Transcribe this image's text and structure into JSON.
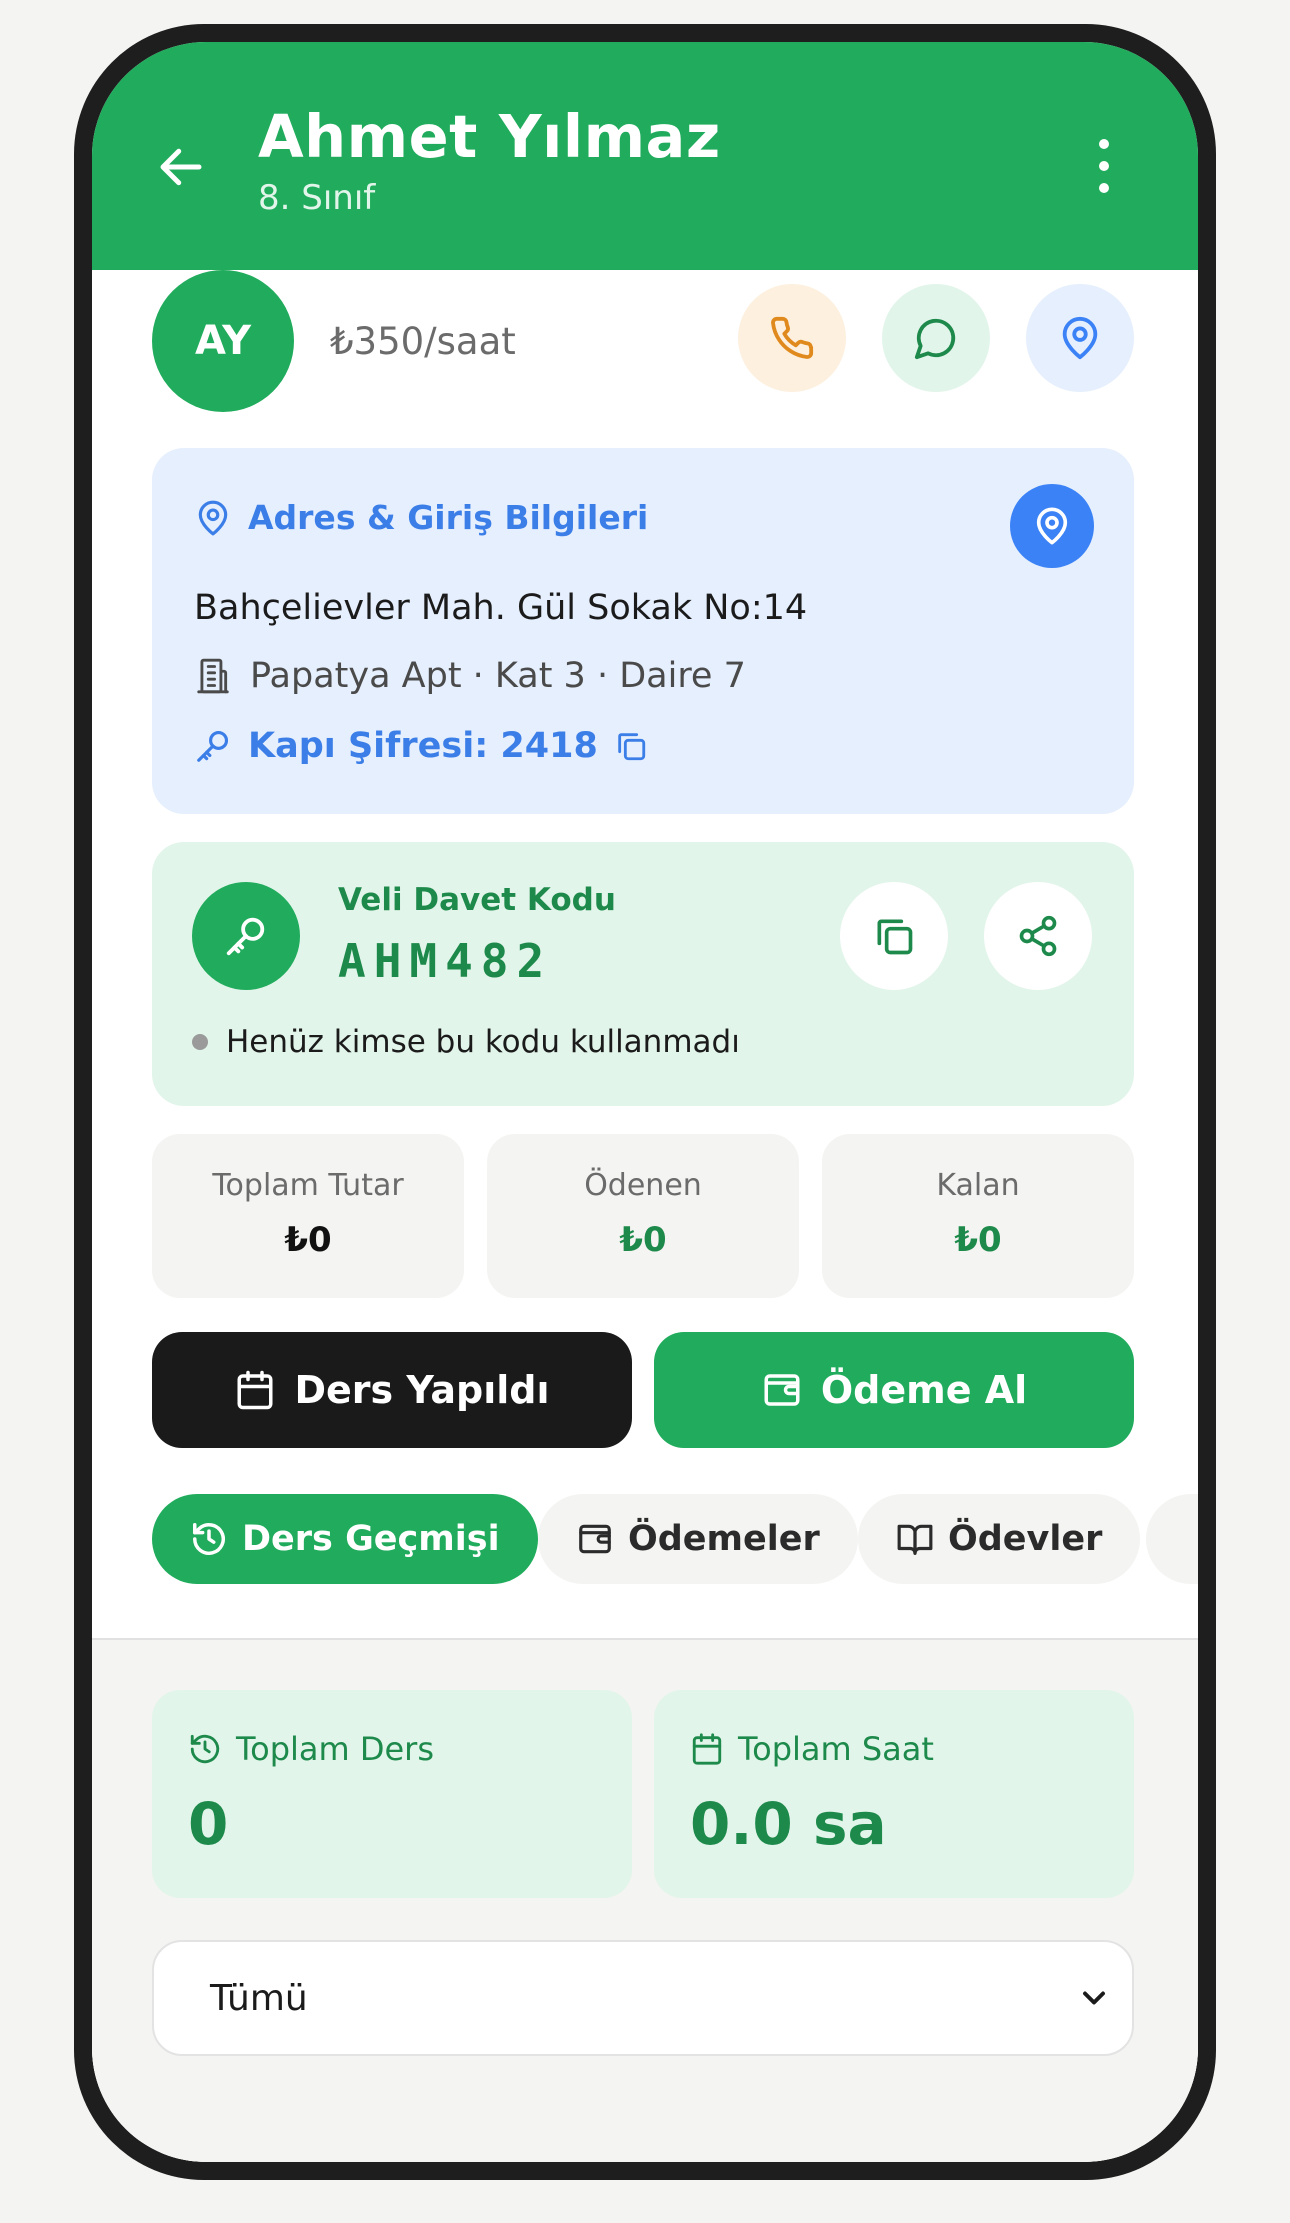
{
  "header": {
    "title": "Ahmet Yılmaz",
    "subtitle": "8. Sınıf"
  },
  "profile": {
    "initials": "AY",
    "rate": "₺350/saat"
  },
  "address": {
    "heading": "Adres & Giriş Bilgileri",
    "line": "Bahçelievler Mah. Gül Sokak No:14",
    "apartment": "Papatya Apt · Kat 3 · Daire 7",
    "door_code": "Kapı Şifresi: 2418"
  },
  "invite": {
    "label": "Veli Davet Kodu",
    "code": "AHM482",
    "status": "Henüz kimse bu kodu kullanmadı"
  },
  "stats": [
    {
      "label": "Toplam Tutar",
      "value": "₺0",
      "color": "#111111"
    },
    {
      "label": "Ödenen",
      "value": "₺0",
      "color": "#1d8a4b"
    },
    {
      "label": "Kalan",
      "value": "₺0",
      "color": "#1d8a4b"
    }
  ],
  "actions": {
    "lesson_done": "Ders Yapıldı",
    "take_payment": "Ödeme Al"
  },
  "tabs": [
    {
      "label": "Ders Geçmişi",
      "active": true
    },
    {
      "label": "Ödemeler",
      "active": false
    },
    {
      "label": "Ödevler",
      "active": false
    }
  ],
  "summary": [
    {
      "label": "Toplam Ders",
      "value": "0"
    },
    {
      "label": "Toplam Saat",
      "value": "0.0 sa"
    }
  ],
  "filter": {
    "selected": "Tümü"
  },
  "colors": {
    "primary": "#20ac5c",
    "blue": "#3b82f6",
    "dark": "#1a1a1a"
  }
}
